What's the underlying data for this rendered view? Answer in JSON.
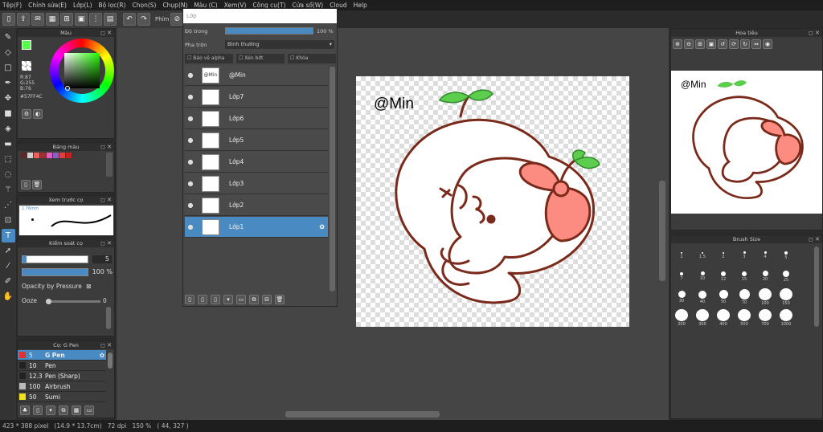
{
  "menu": [
    "Tệp(F)",
    "Chỉnh sửa(E)",
    "Lớp(L)",
    "Bộ lọc(R)",
    "Chọn(S)",
    "Chụp(N)",
    "Màu (C)",
    "Xem(V)",
    "Công cụ(T)",
    "Cửa sổ(W)",
    "Cloud",
    "Help"
  ],
  "toolbar": {
    "label": "Phím"
  },
  "color_panel": {
    "title": "Màu",
    "r": "R:87",
    "g": "G:255",
    "b": "B:76",
    "hex": "#57FF4C",
    "fg": "#57FF4C"
  },
  "palette_panel": {
    "title": "Bảng màu",
    "colors": [
      "#5a2a2a",
      "#d0d0d0",
      "#e86060",
      "#9a3030",
      "#e060c0",
      "#8a60c0",
      "#e04040",
      "#c02020"
    ]
  },
  "preview_panel": {
    "title": "Xem trước cọ",
    "size": "1.76mm"
  },
  "brush_control": {
    "title": "Kiểm soát cọ",
    "size_value": "5",
    "opacity_value": "100 %",
    "opacity_pressure": "Opacity by Pressure",
    "ooze_label": "Ooze",
    "ooze_value": "0"
  },
  "brush_list": {
    "title": "Cọ: G Pen",
    "items": [
      {
        "size": "5",
        "name": "G Pen",
        "color": "#e03030"
      },
      {
        "size": "10",
        "name": "Pen",
        "color": "#222222"
      },
      {
        "size": "12.3",
        "name": "Pen (Sharp)",
        "color": "#222222"
      },
      {
        "size": "100",
        "name": "Airbrush",
        "color": "#bbbbbb"
      },
      {
        "size": "50",
        "name": "Sumi",
        "color": "#f0e020"
      }
    ]
  },
  "layer_panel": {
    "title": "Lớp",
    "opacity_label": "Độ trong",
    "opacity_value": "100 %",
    "blend_label": "Pha trộn",
    "blend_value": "Bình thường",
    "protect_alpha": "Bảo vệ alpha",
    "clipping": "Xén bớt",
    "lock": "Khóa",
    "layers": [
      {
        "name": "@Min",
        "thumb": "@Min"
      },
      {
        "name": "Lớp7",
        "thumb": ""
      },
      {
        "name": "Lớp6",
        "thumb": ""
      },
      {
        "name": "Lớp5",
        "thumb": ""
      },
      {
        "name": "Lớp4",
        "thumb": ""
      },
      {
        "name": "Lớp3",
        "thumb": ""
      },
      {
        "name": "Lớp2",
        "thumb": ""
      },
      {
        "name": "Lớp1",
        "thumb": ""
      }
    ]
  },
  "navigator": {
    "title": "Hoa tiêu",
    "watermark": "@Min"
  },
  "canvas": {
    "watermark": "@Min"
  },
  "brush_size": {
    "title": "Brush Size",
    "sizes": [
      "1",
      "1.5",
      "2",
      "3",
      "4",
      "5",
      "7",
      "10",
      "12",
      "15",
      "20",
      "25",
      "30",
      "40",
      "50",
      "70",
      "100",
      "150",
      "200",
      "300",
      "400",
      "500",
      "700",
      "1000"
    ]
  },
  "status": {
    "text": "423 * 388 pixel   (14.9 * 13.7cm)   72 dpi   150 %   ( 44, 327 )"
  }
}
